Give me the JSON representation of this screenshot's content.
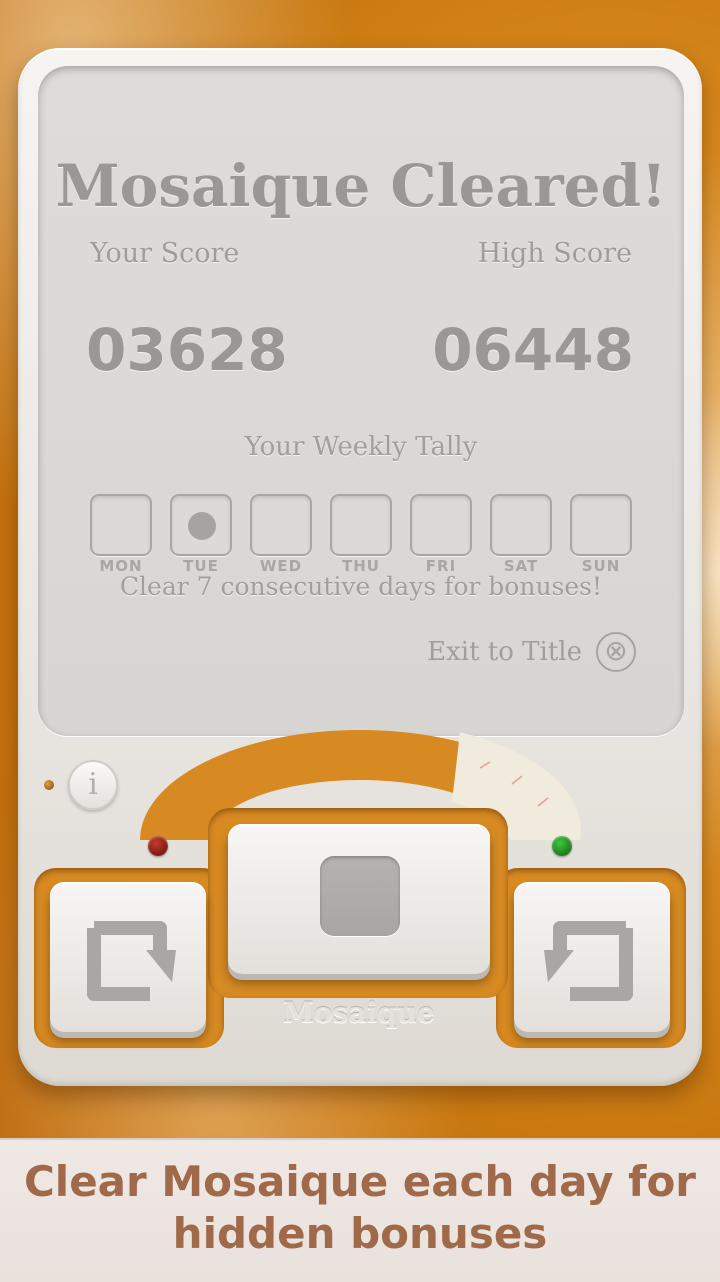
{
  "screen": {
    "title": "Mosaique Cleared!",
    "your_score_label": "Your Score",
    "high_score_label": "High Score",
    "your_score": "03628",
    "high_score": "06448",
    "weekly_tally_title": "Your Weekly Tally",
    "days": [
      {
        "name": "MON",
        "cleared": false
      },
      {
        "name": "TUE",
        "cleared": true
      },
      {
        "name": "WED",
        "cleared": false
      },
      {
        "name": "THU",
        "cleared": false
      },
      {
        "name": "FRI",
        "cleared": false
      },
      {
        "name": "SAT",
        "cleared": false
      },
      {
        "name": "SUN",
        "cleared": false
      }
    ],
    "hint": "Clear 7 consecutive days for bonuses!",
    "exit_label": "Exit to Title",
    "exit_icon": "⊗"
  },
  "controls": {
    "info_icon": "i",
    "brand": "Mosaique",
    "gauge_level": 0.8,
    "left_button_icon": "rotate-counterclockwise-icon",
    "right_button_icon": "rotate-clockwise-icon",
    "center_button_icon": "square-stop-icon"
  },
  "banner": {
    "caption": "Clear Mosaique each day for hidden bonuses"
  },
  "colors": {
    "accent": "#d78a22",
    "banner_text": "#a06a4a",
    "screen_text": "#9a9896"
  }
}
